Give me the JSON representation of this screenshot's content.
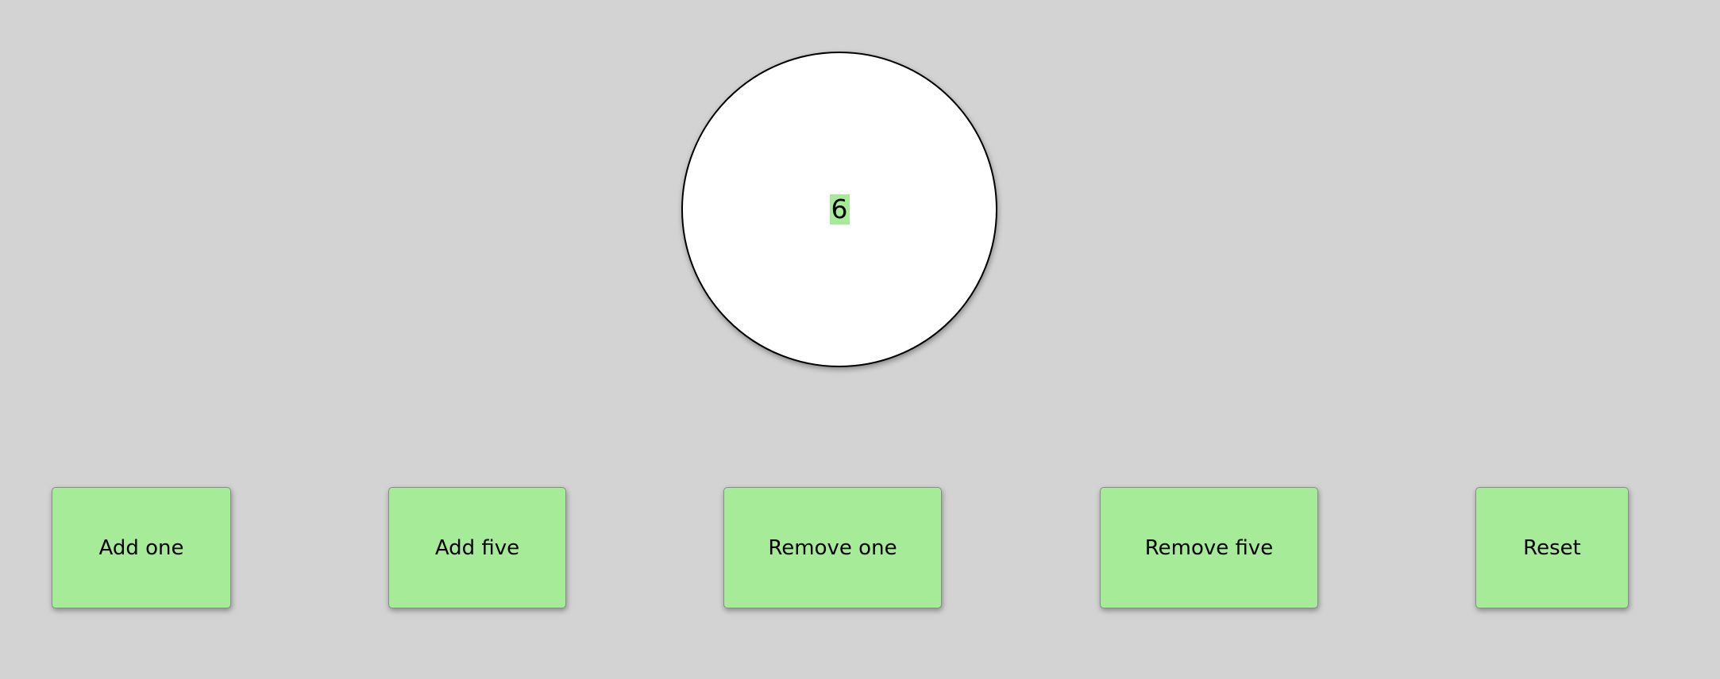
{
  "colors": {
    "background": "#d3d3d3",
    "accent": "#a6eb98",
    "circle": "#ffffff"
  },
  "counter": {
    "value": "6"
  },
  "buttons": [
    {
      "label": "Add one"
    },
    {
      "label": "Add five"
    },
    {
      "label": "Remove one"
    },
    {
      "label": "Remove five"
    },
    {
      "label": "Reset"
    }
  ]
}
